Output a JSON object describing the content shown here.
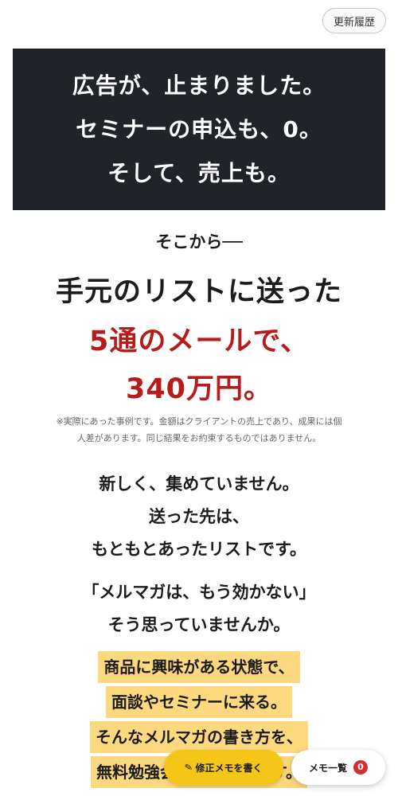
{
  "header": {
    "history_label": "更新履歴"
  },
  "hero": {
    "lines": [
      "広告が、止まりました。",
      "セミナーの申込も、0。",
      "そして、売上も。"
    ]
  },
  "main": {
    "intro": "そこから──",
    "headline": "手元のリストに送った",
    "headline_red_1": "5通のメールで、",
    "headline_red_2": "340万円。",
    "note_lines": [
      "※実際にあった事例です。金額はクライアントの売上であり、成果には個",
      "人差があります。同じ結果をお約束するものではありません。"
    ],
    "block1": [
      "新しく、集めていません。",
      "送った先は、",
      "もともとあったリストです。"
    ],
    "block2": [
      "「メルマガは、もう効かない」",
      "そう思っていませんか。"
    ],
    "highlight_lines": [
      "商品に興味がある状態で、",
      "面談やセミナーに来る。",
      "そんなメルマガの書き方を、",
      "無料勉強会でお話しします。"
    ]
  },
  "floating": {
    "memo_write_label": "修正メモを書く",
    "memo_list_label": "メモ一覧",
    "memo_count": "0"
  },
  "colors": {
    "hero_bg": "#202327",
    "accent_red": "#b71c1c",
    "highlight_yellow": "#fcd87e",
    "memo_button_yellow": "#f5c518",
    "badge_red": "#d32f2f"
  },
  "icons": {
    "memo_write": "pencil-icon"
  }
}
